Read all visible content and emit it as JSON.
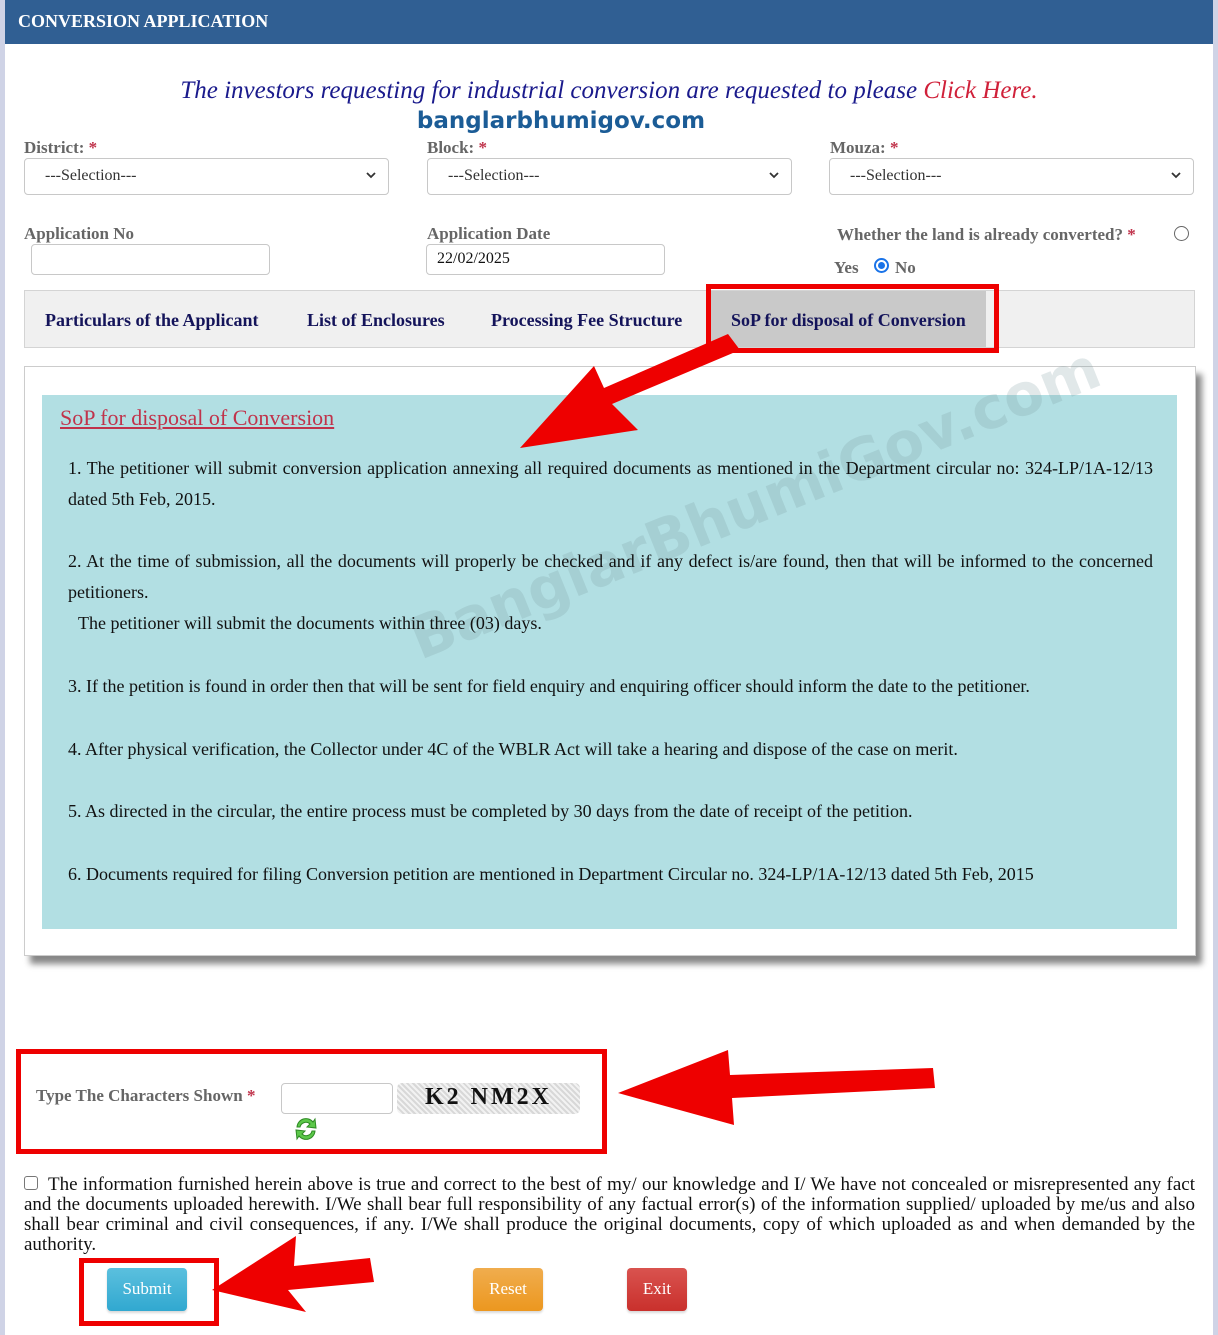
{
  "header": {
    "title": "CONVERSION APPLICATION"
  },
  "notice": {
    "text": "The investors requesting for industrial conversion are requested to please ",
    "link_label": "Click Here."
  },
  "brand": {
    "text": "banglarbhumigov.com"
  },
  "filters": {
    "district": {
      "label": "District:",
      "required_mark": "*",
      "value": "---Selection---"
    },
    "block": {
      "label": "Block:",
      "required_mark": "*",
      "value": "---Selection---"
    },
    "mouza": {
      "label": "Mouza:",
      "required_mark": "*",
      "value": "---Selection---"
    }
  },
  "application": {
    "number": {
      "label": "Application No",
      "value": ""
    },
    "date": {
      "label": "Application Date",
      "value": "22/02/2025"
    },
    "converted": {
      "label": "Whether the land is already converted?",
      "required_mark": "*",
      "options": [
        {
          "label": "Yes",
          "checked": false
        },
        {
          "label": "No",
          "checked": true
        }
      ]
    }
  },
  "tabs": [
    {
      "label": "Particulars of the Applicant",
      "active": false
    },
    {
      "label": "List of Enclosures",
      "active": false
    },
    {
      "label": "Processing Fee Structure",
      "active": false
    },
    {
      "label": "SoP for disposal of Conversion",
      "active": true
    }
  ],
  "sop": {
    "title": "SoP for disposal of Conversion",
    "watermark": "BanglarBhumiGov.com",
    "paragraphs": [
      "1. The petitioner will submit conversion application annexing all required documents as mentioned in the Department circular no: 324-LP/1A-12/13 dated 5th Feb, 2015.",
      "2. At the time of submission, all the documents will properly be checked and if any defect is/are found, then that will be informed to the concerned petitioners.",
      "The petitioner will submit the documents within three (03) days.",
      "3. If the petition is found in order then that will be sent for field enquiry and enquiring officer should inform the date to the petitioner.",
      "4. After physical verification, the Collector under 4C of the WBLR Act will take a hearing and dispose of the case on merit.",
      "5. As directed in the circular, the entire process must be completed by 30 days from the date of receipt of the petition.",
      "6. Documents required for filing Conversion petition are mentioned in Department Circular no. 324-LP/1A-12/13 dated 5th Feb, 2015"
    ]
  },
  "captcha": {
    "label": "Type The Characters Shown",
    "required_mark": "*",
    "input_value": "",
    "code": "K2 NM2X",
    "refresh_icon": "refresh-icon"
  },
  "declaration": {
    "checked": false,
    "text": "The information furnished herein above is true and correct to the best of my/ our knowledge and I/ We have not concealed or misrepresented any fact and the documents uploaded herewith. I/We shall bear full responsibility of any factual error(s) of the information supplied/ uploaded by me/us and also shall bear criminal and civil consequences, if any. I/We shall produce the original documents, copy of which uploaded as and when demanded by the authority."
  },
  "buttons": {
    "submit": "Submit",
    "reset": "Reset",
    "exit": "Exit"
  },
  "colors": {
    "header_bg": "#305f93",
    "panel_bg": "#b2dfe3",
    "required": "#c0334b",
    "tab_text": "#14145a",
    "annotation": "#ee0000",
    "submit": "#31a8d0",
    "reset": "#ec971f",
    "exit": "#c9302c"
  }
}
